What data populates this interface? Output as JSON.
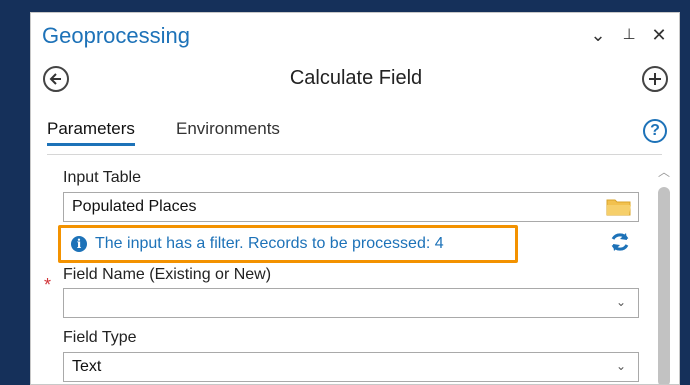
{
  "pane": {
    "title": "Geoprocessing",
    "controls": {
      "options": "⌄",
      "pin": "⊥",
      "close": "✕"
    }
  },
  "tool": {
    "title": "Calculate Field"
  },
  "tabs": [
    {
      "label": "Parameters",
      "active": true
    },
    {
      "label": "Environments",
      "active": false
    }
  ],
  "form": {
    "input_table": {
      "label": "Input Table",
      "value": "Populated Places"
    },
    "info_message": "The input has a filter. Records to be processed: 4",
    "field_name": {
      "label": "Field Name (Existing or New)",
      "value": "",
      "required_marker": "*"
    },
    "field_type": {
      "label": "Field Type",
      "value": "Text"
    }
  },
  "colors": {
    "accent": "#1d72b8",
    "highlight": "#f39200",
    "required": "#d13438",
    "folder": "#f2c14e"
  },
  "icons": [
    "back-arrow-icon",
    "add-icon",
    "help-icon",
    "folder-icon",
    "refresh-icon",
    "info-icon"
  ]
}
